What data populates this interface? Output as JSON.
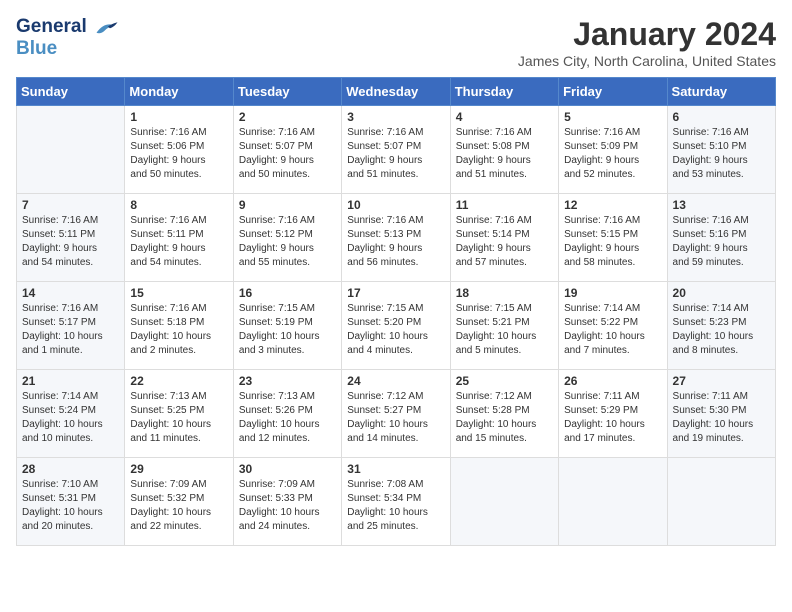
{
  "header": {
    "logo_line1": "General",
    "logo_line2": "Blue",
    "main_title": "January 2024",
    "subtitle": "James City, North Carolina, United States"
  },
  "days_of_week": [
    "Sunday",
    "Monday",
    "Tuesday",
    "Wednesday",
    "Thursday",
    "Friday",
    "Saturday"
  ],
  "weeks": [
    [
      {
        "num": "",
        "info": ""
      },
      {
        "num": "1",
        "info": "Sunrise: 7:16 AM\nSunset: 5:06 PM\nDaylight: 9 hours\nand 50 minutes."
      },
      {
        "num": "2",
        "info": "Sunrise: 7:16 AM\nSunset: 5:07 PM\nDaylight: 9 hours\nand 50 minutes."
      },
      {
        "num": "3",
        "info": "Sunrise: 7:16 AM\nSunset: 5:07 PM\nDaylight: 9 hours\nand 51 minutes."
      },
      {
        "num": "4",
        "info": "Sunrise: 7:16 AM\nSunset: 5:08 PM\nDaylight: 9 hours\nand 51 minutes."
      },
      {
        "num": "5",
        "info": "Sunrise: 7:16 AM\nSunset: 5:09 PM\nDaylight: 9 hours\nand 52 minutes."
      },
      {
        "num": "6",
        "info": "Sunrise: 7:16 AM\nSunset: 5:10 PM\nDaylight: 9 hours\nand 53 minutes."
      }
    ],
    [
      {
        "num": "7",
        "info": "Sunrise: 7:16 AM\nSunset: 5:11 PM\nDaylight: 9 hours\nand 54 minutes."
      },
      {
        "num": "8",
        "info": "Sunrise: 7:16 AM\nSunset: 5:11 PM\nDaylight: 9 hours\nand 54 minutes."
      },
      {
        "num": "9",
        "info": "Sunrise: 7:16 AM\nSunset: 5:12 PM\nDaylight: 9 hours\nand 55 minutes."
      },
      {
        "num": "10",
        "info": "Sunrise: 7:16 AM\nSunset: 5:13 PM\nDaylight: 9 hours\nand 56 minutes."
      },
      {
        "num": "11",
        "info": "Sunrise: 7:16 AM\nSunset: 5:14 PM\nDaylight: 9 hours\nand 57 minutes."
      },
      {
        "num": "12",
        "info": "Sunrise: 7:16 AM\nSunset: 5:15 PM\nDaylight: 9 hours\nand 58 minutes."
      },
      {
        "num": "13",
        "info": "Sunrise: 7:16 AM\nSunset: 5:16 PM\nDaylight: 9 hours\nand 59 minutes."
      }
    ],
    [
      {
        "num": "14",
        "info": "Sunrise: 7:16 AM\nSunset: 5:17 PM\nDaylight: 10 hours\nand 1 minute."
      },
      {
        "num": "15",
        "info": "Sunrise: 7:16 AM\nSunset: 5:18 PM\nDaylight: 10 hours\nand 2 minutes."
      },
      {
        "num": "16",
        "info": "Sunrise: 7:15 AM\nSunset: 5:19 PM\nDaylight: 10 hours\nand 3 minutes."
      },
      {
        "num": "17",
        "info": "Sunrise: 7:15 AM\nSunset: 5:20 PM\nDaylight: 10 hours\nand 4 minutes."
      },
      {
        "num": "18",
        "info": "Sunrise: 7:15 AM\nSunset: 5:21 PM\nDaylight: 10 hours\nand 5 minutes."
      },
      {
        "num": "19",
        "info": "Sunrise: 7:14 AM\nSunset: 5:22 PM\nDaylight: 10 hours\nand 7 minutes."
      },
      {
        "num": "20",
        "info": "Sunrise: 7:14 AM\nSunset: 5:23 PM\nDaylight: 10 hours\nand 8 minutes."
      }
    ],
    [
      {
        "num": "21",
        "info": "Sunrise: 7:14 AM\nSunset: 5:24 PM\nDaylight: 10 hours\nand 10 minutes."
      },
      {
        "num": "22",
        "info": "Sunrise: 7:13 AM\nSunset: 5:25 PM\nDaylight: 10 hours\nand 11 minutes."
      },
      {
        "num": "23",
        "info": "Sunrise: 7:13 AM\nSunset: 5:26 PM\nDaylight: 10 hours\nand 12 minutes."
      },
      {
        "num": "24",
        "info": "Sunrise: 7:12 AM\nSunset: 5:27 PM\nDaylight: 10 hours\nand 14 minutes."
      },
      {
        "num": "25",
        "info": "Sunrise: 7:12 AM\nSunset: 5:28 PM\nDaylight: 10 hours\nand 15 minutes."
      },
      {
        "num": "26",
        "info": "Sunrise: 7:11 AM\nSunset: 5:29 PM\nDaylight: 10 hours\nand 17 minutes."
      },
      {
        "num": "27",
        "info": "Sunrise: 7:11 AM\nSunset: 5:30 PM\nDaylight: 10 hours\nand 19 minutes."
      }
    ],
    [
      {
        "num": "28",
        "info": "Sunrise: 7:10 AM\nSunset: 5:31 PM\nDaylight: 10 hours\nand 20 minutes."
      },
      {
        "num": "29",
        "info": "Sunrise: 7:09 AM\nSunset: 5:32 PM\nDaylight: 10 hours\nand 22 minutes."
      },
      {
        "num": "30",
        "info": "Sunrise: 7:09 AM\nSunset: 5:33 PM\nDaylight: 10 hours\nand 24 minutes."
      },
      {
        "num": "31",
        "info": "Sunrise: 7:08 AM\nSunset: 5:34 PM\nDaylight: 10 hours\nand 25 minutes."
      },
      {
        "num": "",
        "info": ""
      },
      {
        "num": "",
        "info": ""
      },
      {
        "num": "",
        "info": ""
      }
    ]
  ]
}
